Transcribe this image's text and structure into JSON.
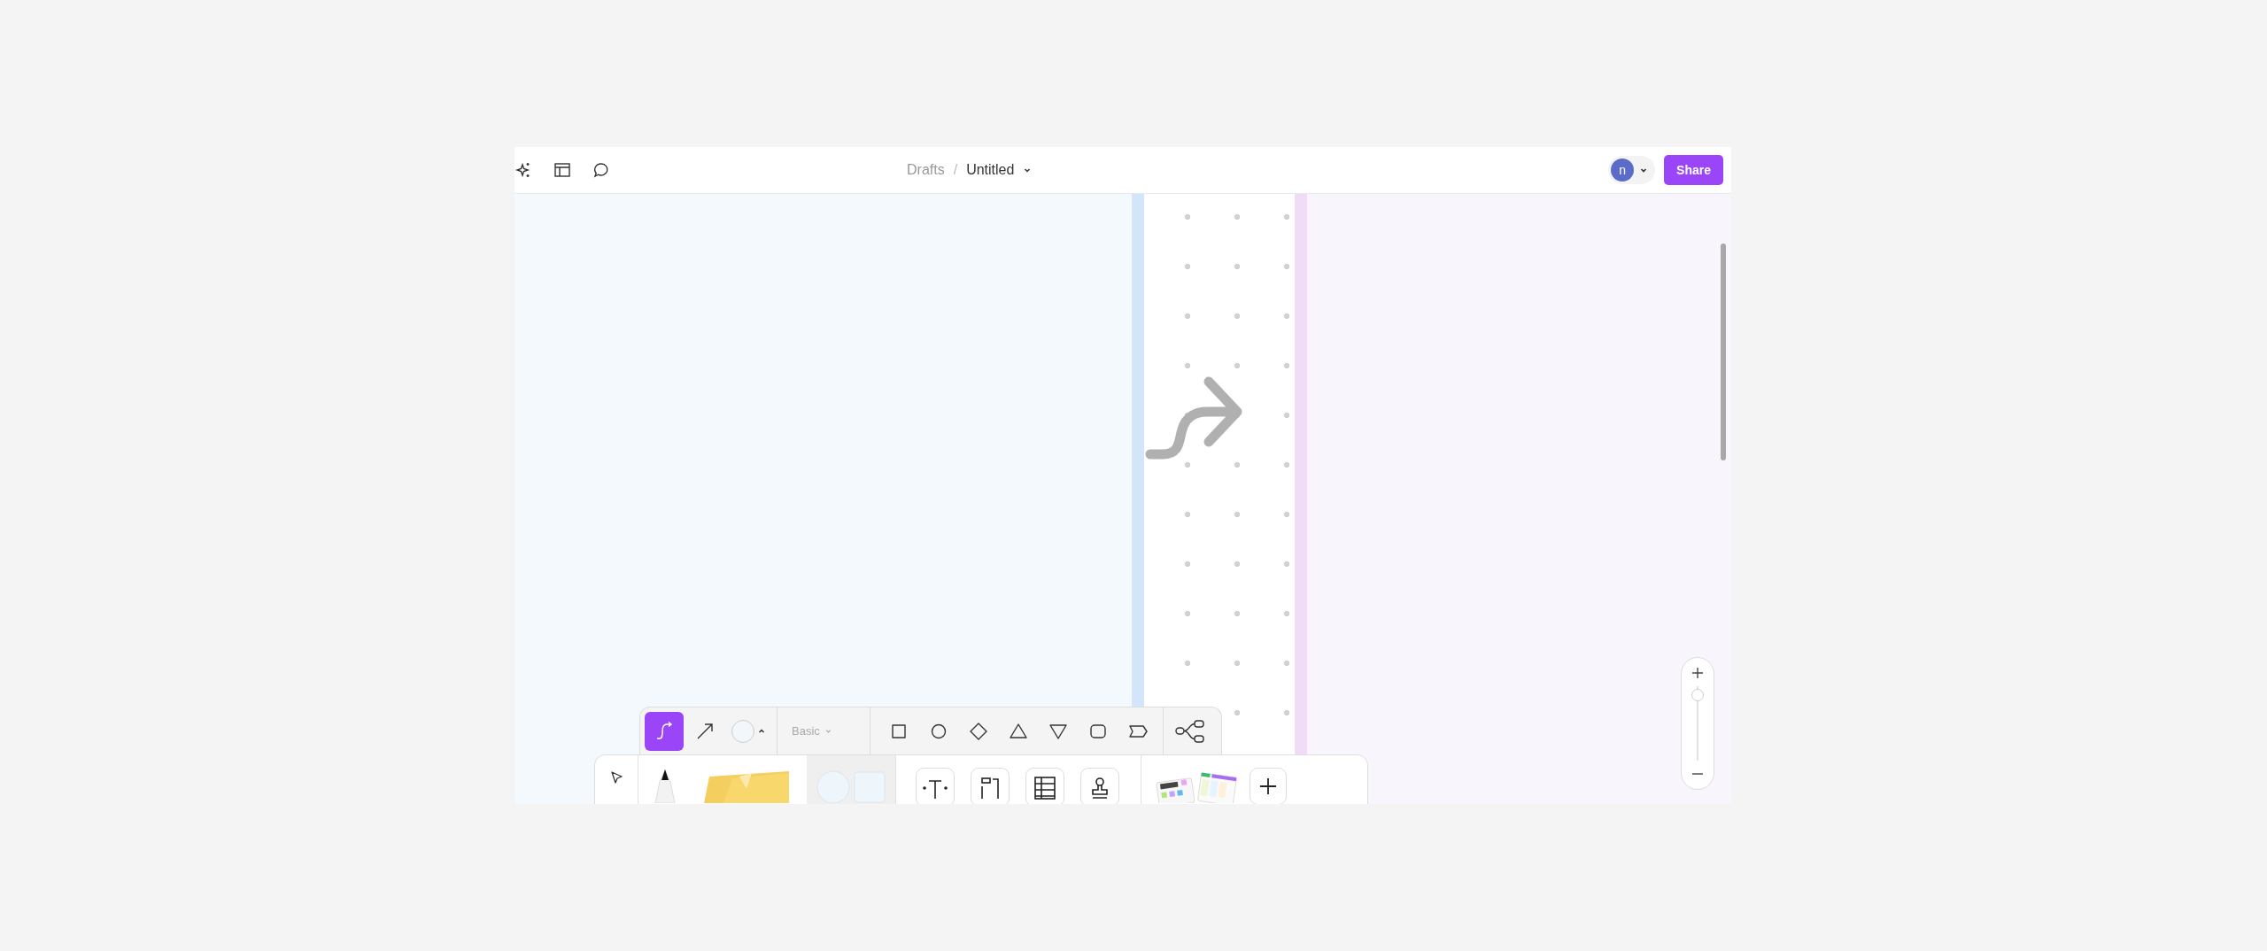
{
  "breadcrumb": {
    "parent": "Drafts",
    "separator": "/",
    "title": "Untitled"
  },
  "user": {
    "avatar_letter": "n"
  },
  "share_button": "Share",
  "connector_tools": [
    {
      "kind": "curved",
      "selected": true
    },
    {
      "kind": "straight",
      "selected": false
    }
  ],
  "style_preset": "Basic",
  "shapes": [
    {
      "kind": "square"
    },
    {
      "kind": "circle"
    },
    {
      "kind": "diamond"
    },
    {
      "kind": "triangle"
    },
    {
      "kind": "triangle-down"
    },
    {
      "kind": "rounded"
    },
    {
      "kind": "tag"
    }
  ],
  "tools": [
    {
      "kind": "pen",
      "selected": false
    },
    {
      "kind": "sticky",
      "selected": false
    },
    {
      "kind": "shapes",
      "selected": true
    }
  ],
  "insert_tools": [
    {
      "kind": "text"
    },
    {
      "kind": "frame"
    },
    {
      "kind": "table"
    },
    {
      "kind": "stamp"
    }
  ],
  "zoom": {
    "level": 0.88
  }
}
